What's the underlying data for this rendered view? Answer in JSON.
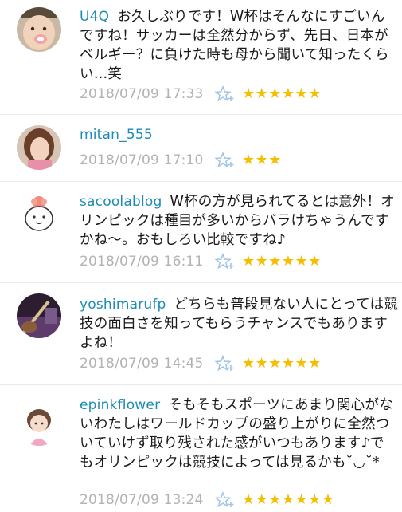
{
  "colors": {
    "username": "#1c8bb6",
    "timestamp": "#b3b3b3",
    "star": "#f5be00",
    "star_add": "#9ec4e6"
  },
  "comments": [
    {
      "user": "U4Q",
      "text": "お久しぶりです！W杯はそんなにすごいんですね！サッカーは全然分からず、先日、日本がベルギー？に負けた時も母から聞いて知ったくらい…笑",
      "time": "2018/07/09 17:33",
      "stars": "★★★★★★",
      "star_count": 6,
      "avatar_icon": "smiling-person-avatar-icon"
    },
    {
      "user": "mitan_555",
      "text": "",
      "time": "2018/07/09 17:10",
      "stars": "★★★",
      "star_count": 3,
      "avatar_icon": "woman-portrait-avatar-icon"
    },
    {
      "user": "sacoolablog",
      "text": "W杯の方が見られてるとは意外！オリンピックは種目が多いからバラけちゃうんですかね〜。おもしろい比較ですね♪",
      "time": "2018/07/09 16:11",
      "stars": "★★★★★★",
      "star_count": 6,
      "avatar_icon": "cartoon-face-avatar-icon"
    },
    {
      "user": "yoshimarufp",
      "text": "どちらも普段見ない人にとっては競技の面白さを知ってもらうチャンスでもありますよね！",
      "time": "2018/07/09 14:45",
      "stars": "★★★★★★",
      "star_count": 6,
      "avatar_icon": "guitar-photo-avatar-icon"
    },
    {
      "user": "epinkflower",
      "text": "そもそもスポーツにあまり関心がないわたしはワールドカップの盛り上がりに全然ついていけず取り残された感がいつもあります♪でもオリンピックは競技によっては見るかも˘◡˘*",
      "time": "2018/07/09 13:24",
      "stars": "★★★★★★★",
      "star_count": 7,
      "avatar_icon": "illustrated-girl-avatar-icon"
    }
  ]
}
